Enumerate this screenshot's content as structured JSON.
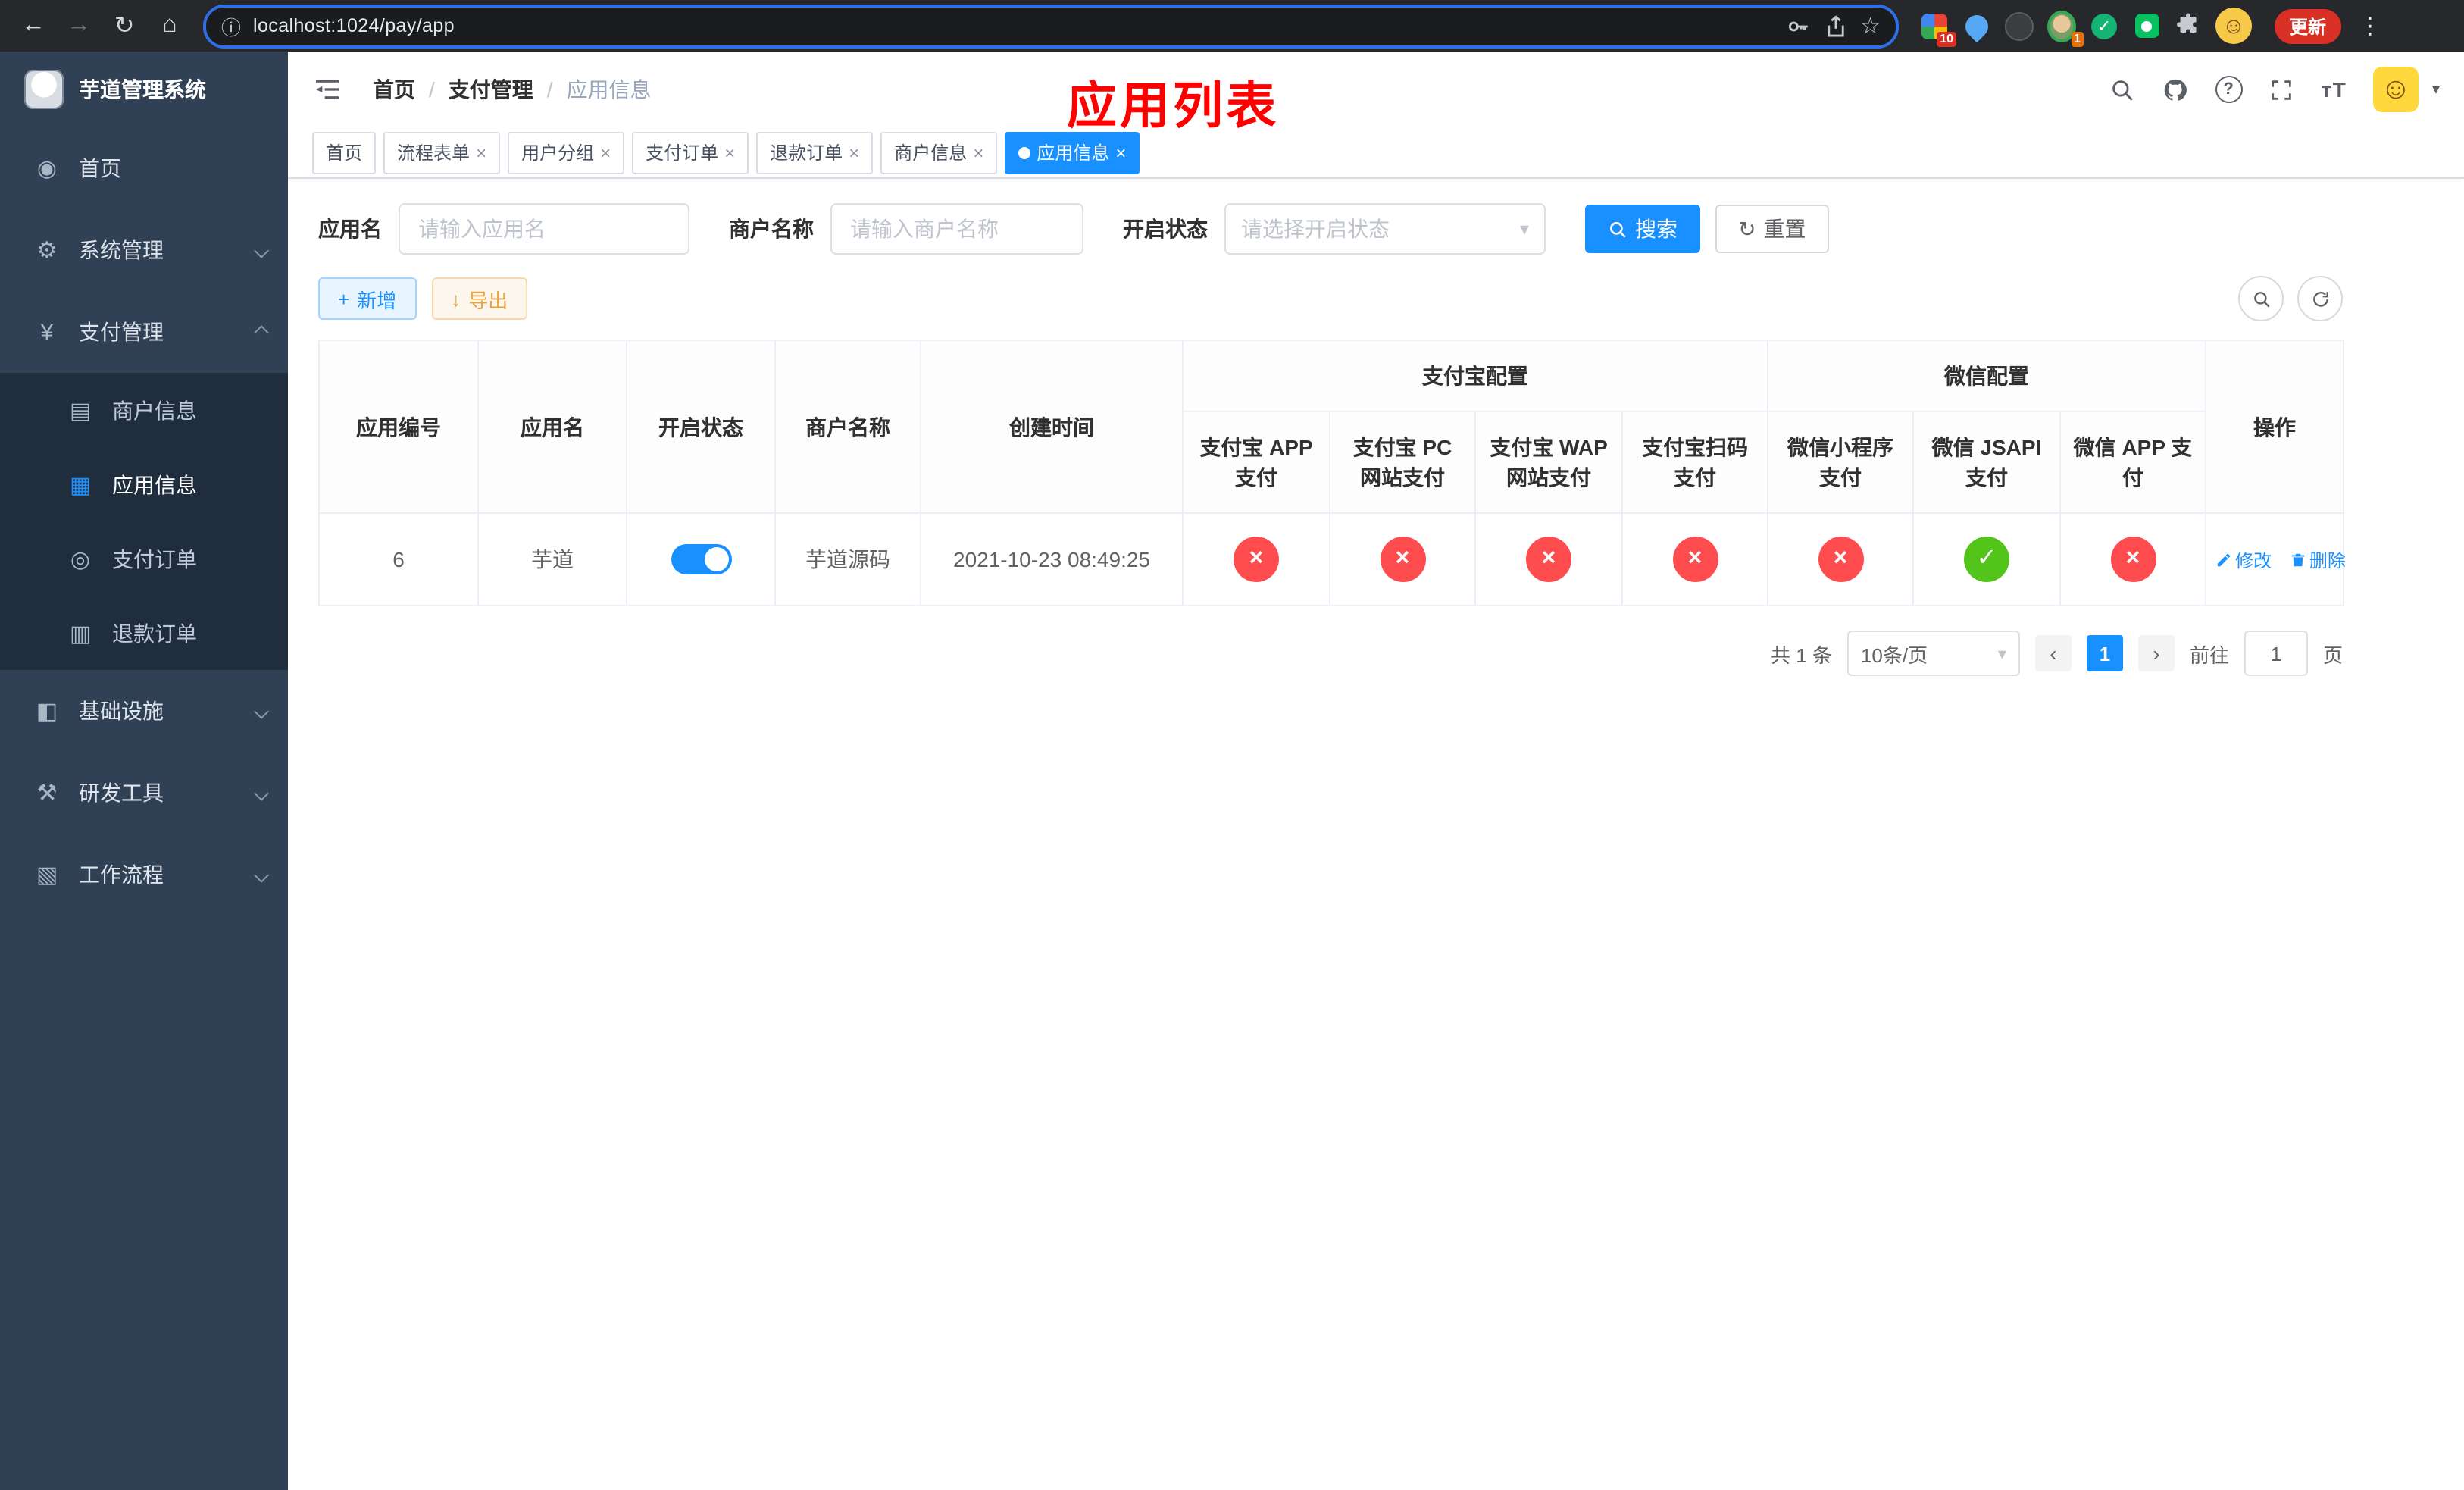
{
  "colors": {
    "accent": "#1890ff",
    "success": "#52c41a",
    "danger": "#ff4d4f",
    "warning": "#e6a23c",
    "overlay": "#ff0000",
    "sidebar_bg": "#304156",
    "submenu_bg": "#1f2d3d"
  },
  "symbols": {
    "check": "✓",
    "cross": "×"
  },
  "icons": {
    "back": "←",
    "forward": "→",
    "reload": "↻",
    "home": "⌂",
    "info": "ⓘ",
    "star": "☆",
    "kebab": "⋮",
    "smiley": "☺",
    "help": "?",
    "fontsize": "тT",
    "caret": "▾",
    "close": "×",
    "plus": "+",
    "download": "↓",
    "slash": "/",
    "prev": "‹",
    "next": "›"
  },
  "browser": {
    "url": "localhost:1024/pay/app",
    "update_label": "更新",
    "ext_badge_colorful": "10",
    "ext_badge_avatar": "1"
  },
  "sidebar": {
    "title": "芋道管理系统",
    "items": [
      {
        "label": "首页",
        "glyph": "◉"
      },
      {
        "label": "系统管理",
        "glyph": "⚙"
      },
      {
        "label": "支付管理",
        "glyph": "¥"
      },
      {
        "label": "基础设施",
        "glyph": "◧"
      },
      {
        "label": "研发工具",
        "glyph": "⚒"
      },
      {
        "label": "工作流程",
        "glyph": "▧"
      }
    ],
    "payment_children": [
      {
        "label": "商户信息",
        "glyph": "▤"
      },
      {
        "label": "应用信息",
        "glyph": "▦"
      },
      {
        "label": "支付订单",
        "glyph": "◎"
      },
      {
        "label": "退款订单",
        "glyph": "▥"
      }
    ]
  },
  "header": {
    "breadcrumb": [
      "首页",
      "支付管理",
      "应用信息"
    ],
    "overlay_title": "应用列表"
  },
  "tabs": [
    {
      "label": "首页"
    },
    {
      "label": "流程表单"
    },
    {
      "label": "用户分组"
    },
    {
      "label": "支付订单"
    },
    {
      "label": "退款订单"
    },
    {
      "label": "商户信息"
    },
    {
      "label": "应用信息"
    }
  ],
  "filters": {
    "app_name_label": "应用名",
    "app_name_placeholder": "请输入应用名",
    "merchant_label": "商户名称",
    "merchant_placeholder": "请输入商户名称",
    "status_label": "开启状态",
    "status_placeholder": "请选择开启状态",
    "search_label": "搜索",
    "reset_label": "重置"
  },
  "toolbar": {
    "add_label": "新增",
    "export_label": "导出"
  },
  "table": {
    "group_alipay": "支付宝配置",
    "group_wechat": "微信配置",
    "columns": [
      "应用编号",
      "应用名",
      "开启状态",
      "商户名称",
      "创建时间",
      "支付宝 APP 支付",
      "支付宝 PC 网站支付",
      "支付宝 WAP 网站支付",
      "支付宝扫码支付",
      "微信小程序支付",
      "微信 JSAPI 支付",
      "微信 APP 支付",
      "操作"
    ],
    "rows": [
      {
        "id": "6",
        "name": "芋道",
        "enabled": true,
        "merchant": "芋道源码",
        "created": "2021-10-23 08:49:25",
        "alipay_app": false,
        "alipay_pc": false,
        "alipay_wap": false,
        "alipay_qr": false,
        "wx_mini": false,
        "wx_jsapi": true,
        "wx_app": false,
        "edit_label": "修改",
        "delete_label": "删除"
      }
    ]
  },
  "pagination": {
    "total": "共 1 条",
    "page_size": "10条/页",
    "current_page": "1",
    "goto_label": "前往",
    "goto_value": "1",
    "page_suffix": "页"
  }
}
